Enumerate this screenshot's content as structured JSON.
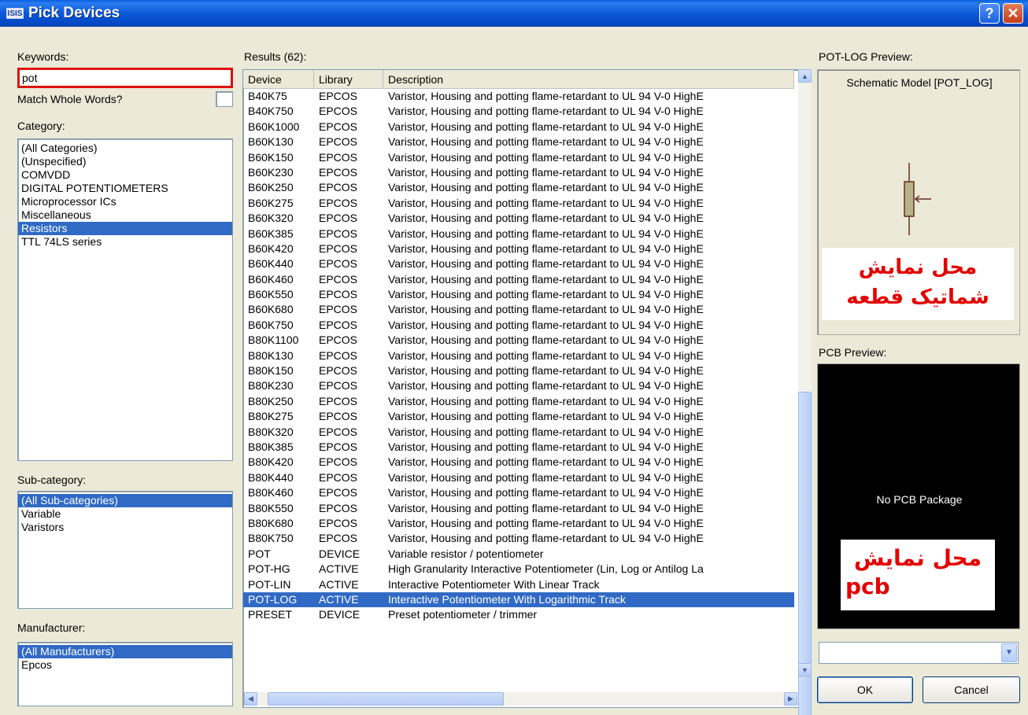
{
  "window": {
    "title": "Pick Devices",
    "app_icon_text": "ISIS",
    "help_label": "?",
    "close_label": "✕"
  },
  "left": {
    "keywords_label": "Keywords:",
    "keywords_value": "pot",
    "match_whole_words_label": "Match Whole Words?",
    "match_whole_words_checked": false,
    "category_label": "Category:",
    "categories": [
      "(All Categories)",
      "(Unspecified)",
      "COMVDD",
      "DIGITAL POTENTIOMETERS",
      "Microprocessor ICs",
      "Miscellaneous",
      "Resistors",
      "TTL 74LS series"
    ],
    "selected_category": "Resistors",
    "subcategory_label": "Sub-category:",
    "subcategories": [
      "(All Sub-categories)",
      "Variable",
      "Varistors"
    ],
    "selected_subcategory": "(All Sub-categories)",
    "manufacturer_label": "Manufacturer:",
    "manufacturers": [
      "(All Manufacturers)",
      "Epcos"
    ],
    "selected_manufacturer": "(All Manufacturers)"
  },
  "results": {
    "label": "Results (62):",
    "columns": [
      "Device",
      "Library",
      "Description"
    ],
    "selected_device": "POT-LOG",
    "rows": [
      [
        "B40K75",
        "EPCOS",
        "Varistor, Housing and potting flame-retardant to UL 94 V-0 HighE"
      ],
      [
        "B40K750",
        "EPCOS",
        "Varistor, Housing and potting flame-retardant to UL 94 V-0 HighE"
      ],
      [
        "B60K1000",
        "EPCOS",
        "Varistor, Housing and potting flame-retardant to UL 94 V-0 HighE"
      ],
      [
        "B60K130",
        "EPCOS",
        "Varistor, Housing and potting flame-retardant to UL 94 V-0 HighE"
      ],
      [
        "B60K150",
        "EPCOS",
        "Varistor, Housing and potting flame-retardant to UL 94 V-0 HighE"
      ],
      [
        "B60K230",
        "EPCOS",
        "Varistor, Housing and potting flame-retardant to UL 94 V-0 HighE"
      ],
      [
        "B60K250",
        "EPCOS",
        "Varistor, Housing and potting flame-retardant to UL 94 V-0 HighE"
      ],
      [
        "B60K275",
        "EPCOS",
        "Varistor, Housing and potting flame-retardant to UL 94 V-0 HighE"
      ],
      [
        "B60K320",
        "EPCOS",
        "Varistor, Housing and potting flame-retardant to UL 94 V-0 HighE"
      ],
      [
        "B60K385",
        "EPCOS",
        "Varistor, Housing and potting flame-retardant to UL 94 V-0 HighE"
      ],
      [
        "B60K420",
        "EPCOS",
        "Varistor, Housing and potting flame-retardant to UL 94 V-0 HighE"
      ],
      [
        "B60K440",
        "EPCOS",
        "Varistor, Housing and potting flame-retardant to UL 94 V-0 HighE"
      ],
      [
        "B60K460",
        "EPCOS",
        "Varistor, Housing and potting flame-retardant to UL 94 V-0 HighE"
      ],
      [
        "B60K550",
        "EPCOS",
        "Varistor, Housing and potting flame-retardant to UL 94 V-0 HighE"
      ],
      [
        "B60K680",
        "EPCOS",
        "Varistor, Housing and potting flame-retardant to UL 94 V-0 HighE"
      ],
      [
        "B60K750",
        "EPCOS",
        "Varistor, Housing and potting flame-retardant to UL 94 V-0 HighE"
      ],
      [
        "B80K1100",
        "EPCOS",
        "Varistor, Housing and potting flame-retardant to UL 94 V-0 HighE"
      ],
      [
        "B80K130",
        "EPCOS",
        "Varistor, Housing and potting flame-retardant to UL 94 V-0 HighE"
      ],
      [
        "B80K150",
        "EPCOS",
        "Varistor, Housing and potting flame-retardant to UL 94 V-0 HighE"
      ],
      [
        "B80K230",
        "EPCOS",
        "Varistor, Housing and potting flame-retardant to UL 94 V-0 HighE"
      ],
      [
        "B80K250",
        "EPCOS",
        "Varistor, Housing and potting flame-retardant to UL 94 V-0 HighE"
      ],
      [
        "B80K275",
        "EPCOS",
        "Varistor, Housing and potting flame-retardant to UL 94 V-0 HighE"
      ],
      [
        "B80K320",
        "EPCOS",
        "Varistor, Housing and potting flame-retardant to UL 94 V-0 HighE"
      ],
      [
        "B80K385",
        "EPCOS",
        "Varistor, Housing and potting flame-retardant to UL 94 V-0 HighE"
      ],
      [
        "B80K420",
        "EPCOS",
        "Varistor, Housing and potting flame-retardant to UL 94 V-0 HighE"
      ],
      [
        "B80K440",
        "EPCOS",
        "Varistor, Housing and potting flame-retardant to UL 94 V-0 HighE"
      ],
      [
        "B80K460",
        "EPCOS",
        "Varistor, Housing and potting flame-retardant to UL 94 V-0 HighE"
      ],
      [
        "B80K550",
        "EPCOS",
        "Varistor, Housing and potting flame-retardant to UL 94 V-0 HighE"
      ],
      [
        "B80K680",
        "EPCOS",
        "Varistor, Housing and potting flame-retardant to UL 94 V-0 HighE"
      ],
      [
        "B80K750",
        "EPCOS",
        "Varistor, Housing and potting flame-retardant to UL 94 V-0 HighE"
      ],
      [
        "POT",
        "DEVICE",
        "Variable resistor / potentiometer"
      ],
      [
        "POT-HG",
        "ACTIVE",
        "High Granularity Interactive Potentiometer (Lin, Log or Antilog La"
      ],
      [
        "POT-LIN",
        "ACTIVE",
        "Interactive Potentiometer With Linear Track"
      ],
      [
        "POT-LOG",
        "ACTIVE",
        "Interactive Potentiometer With Logarithmic Track"
      ],
      [
        "PRESET",
        "DEVICE",
        "Preset potentiometer / trimmer"
      ]
    ]
  },
  "preview": {
    "label": "POT-LOG Preview:",
    "schematic_model": "Schematic Model [POT_LOG]",
    "annotation_line1": "محل نمایش",
    "annotation_line2": "شماتیک قطعه"
  },
  "pcb": {
    "label": "PCB Preview:",
    "no_package_text": "No PCB Package",
    "annotation_line1": "محل نمایش",
    "annotation_line2": "pcb",
    "combo_value": ""
  },
  "buttons": {
    "ok": "OK",
    "cancel": "Cancel"
  },
  "colors": {
    "title_bar": "#0b59d6",
    "selection": "#316ac5",
    "highlight_border": "#e01010",
    "annotation_text": "#e30000"
  }
}
